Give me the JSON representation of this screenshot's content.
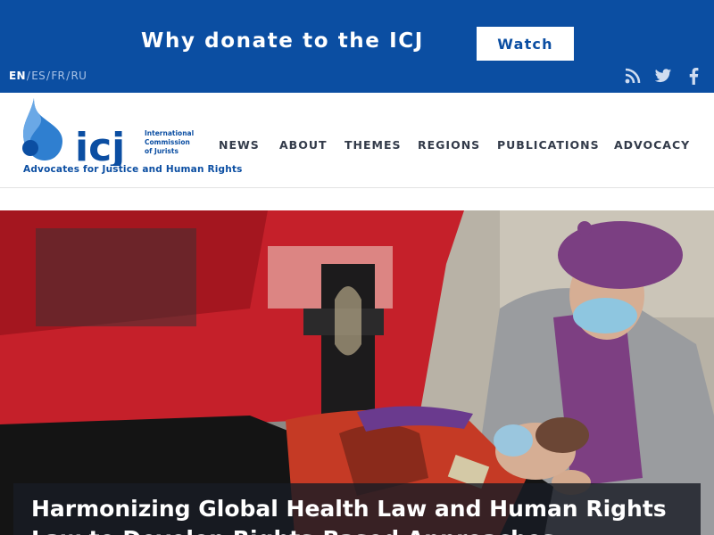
{
  "banner": {
    "donate_text": "Why donate to the ICJ",
    "watch_label": "Watch",
    "languages": [
      {
        "code": "EN",
        "active": true
      },
      {
        "code": "ES",
        "active": false
      },
      {
        "code": "FR",
        "active": false
      },
      {
        "code": "RU",
        "active": false
      }
    ],
    "social": [
      "rss-icon",
      "twitter-icon",
      "facebook-icon"
    ],
    "color": "#0b4ea2"
  },
  "header": {
    "logo_text": "icj",
    "org_name_lines": [
      "International",
      "Commission",
      "of Jurists"
    ],
    "tagline": "Advocates for Justice and Human Rights",
    "nav": [
      "NEWS",
      "ABOUT",
      "THEMES",
      "REGIONS",
      "PUBLICATIONS",
      "ADVOCACY"
    ]
  },
  "hero": {
    "title": "Harmonizing Global Health Law and Human Rights Law to Develop Rights-Based Approaches"
  }
}
